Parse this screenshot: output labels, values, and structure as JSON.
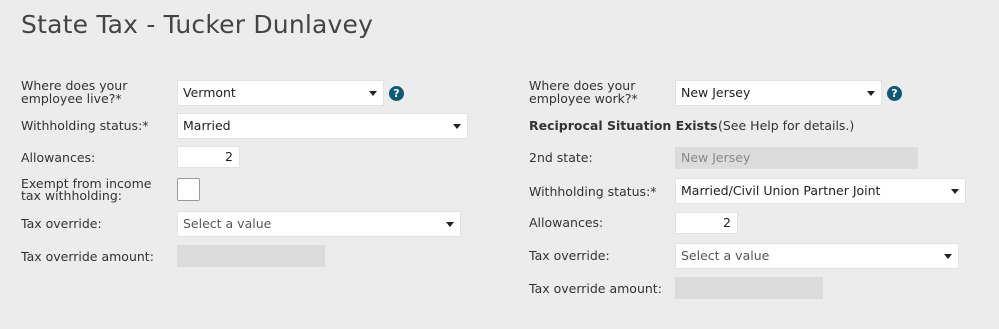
{
  "page": {
    "title": "State Tax - Tucker Dunlavey"
  },
  "left": {
    "live_label": "Where does your employee live?*",
    "live_value": "Vermont",
    "withholding_label": "Withholding status:*",
    "withholding_value": "Married",
    "allowances_label": "Allowances:",
    "allowances_value": "2",
    "exempt_label": "Exempt from income tax withholding:",
    "exempt_checked": false,
    "override_label": "Tax override:",
    "override_placeholder": "Select a value",
    "override_amount_label": "Tax override amount:",
    "override_amount_value": ""
  },
  "right": {
    "work_label": "Where does your employee work?*",
    "work_value": "New Jersey",
    "reciprocal_label": "Reciprocal Situation Exists",
    "reciprocal_help": "(See Help for details.)",
    "second_state_label": "2nd state:",
    "second_state_value": "New Jersey",
    "withholding_label": "Withholding status:*",
    "withholding_value": "Married/Civil Union Partner Joint",
    "allowances_label": "Allowances:",
    "allowances_value": "2",
    "override_label": "Tax override:",
    "override_placeholder": "Select a value",
    "override_amount_label": "Tax override amount:",
    "override_amount_value": ""
  },
  "icons": {
    "help": "help-question-icon",
    "dropdown": "chevron-down-icon"
  },
  "colors": {
    "background": "#ececec",
    "help_icon": "#0d5a78",
    "disabled_field": "#dcdcdc"
  }
}
